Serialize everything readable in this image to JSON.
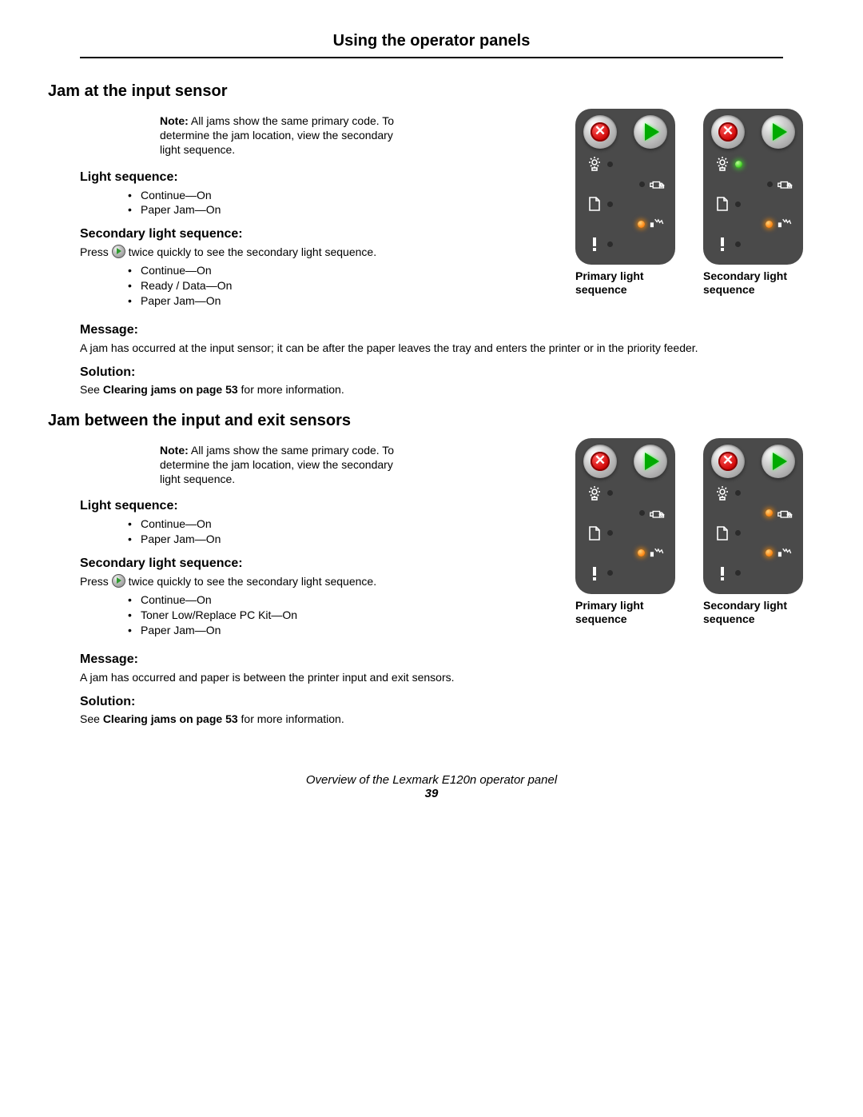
{
  "header": "Using the operator panels",
  "sections": [
    {
      "title": "Jam at the input sensor",
      "note_label": "Note:",
      "note_text": "All jams show the same primary code. To determine the jam location, view the secondary light sequence.",
      "light_heading": "Light sequence:",
      "light_items": [
        "Continue—On",
        "Paper Jam—On"
      ],
      "secondary_heading": "Secondary light sequence:",
      "press_before": "Press ",
      "press_after": " twice quickly to see the secondary light sequence.",
      "secondary_items": [
        "Continue—On",
        "Ready / Data—On",
        "Paper Jam—On"
      ],
      "message_heading": "Message:",
      "message_text": "A jam has occurred at the input sensor; it can be after the paper leaves the tray and enters the printer or in the priority feeder.",
      "solution_heading": "Solution:",
      "solution_before": "See ",
      "solution_bold": "Clearing jams on page 53",
      "solution_after": " for more information.",
      "primary_caption": "Primary light sequence",
      "secondary_caption": "Secondary light sequence",
      "primary_leds": {
        "ready": "off",
        "toner": "off",
        "paper": "off",
        "jam": "orange",
        "error": "off"
      },
      "secondary_leds": {
        "ready": "green",
        "toner": "off",
        "paper": "off",
        "jam": "orange",
        "error": "off"
      }
    },
    {
      "title": "Jam between the input and exit sensors",
      "note_label": "Note:",
      "note_text": "All jams show the same primary code. To determine the jam location, view the secondary light sequence.",
      "light_heading": "Light sequence:",
      "light_items": [
        "Continue—On",
        "Paper Jam—On"
      ],
      "secondary_heading": "Secondary light sequence:",
      "press_before": "Press ",
      "press_after": " twice quickly to see the secondary light sequence.",
      "secondary_items": [
        "Continue—On",
        "Toner Low/Replace PC Kit—On",
        "Paper Jam—On"
      ],
      "message_heading": "Message:",
      "message_text": "A jam has occurred and paper is between the printer input and exit sensors.",
      "solution_heading": "Solution:",
      "solution_before": "See ",
      "solution_bold": "Clearing jams on page 53",
      "solution_after": " for more information.",
      "primary_caption": "Primary light sequence",
      "secondary_caption": "Secondary light sequence",
      "primary_leds": {
        "ready": "off",
        "toner": "off",
        "paper": "off",
        "jam": "orange",
        "error": "off"
      },
      "secondary_leds": {
        "ready": "off",
        "toner": "orange",
        "paper": "off",
        "jam": "orange",
        "error": "off"
      }
    }
  ],
  "footer_text": "Overview of the Lexmark E120n operator panel",
  "footer_page": "39"
}
